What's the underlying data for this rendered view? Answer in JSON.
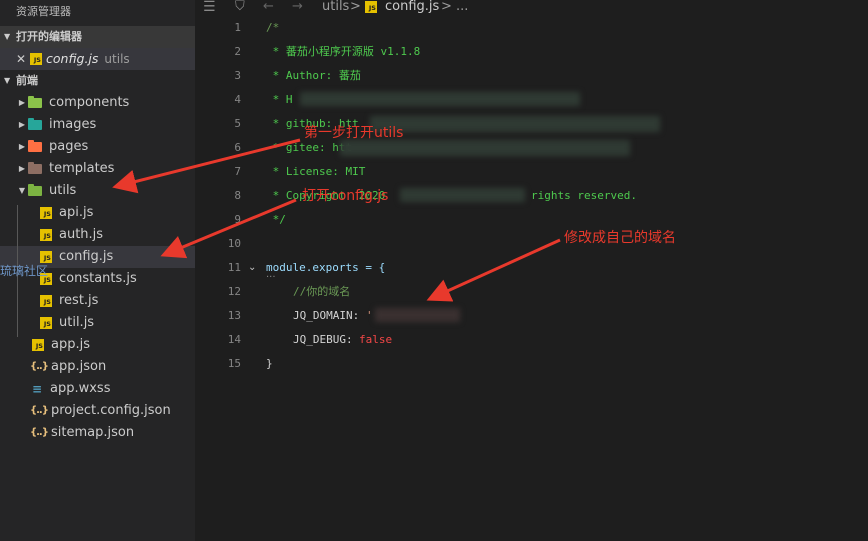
{
  "sidebar": {
    "title": "资源管理器",
    "open_editors": {
      "label": "打开的编辑器",
      "file": "config.js",
      "dir": "utils"
    },
    "project": {
      "label": "前端"
    },
    "tree": [
      {
        "label": "components",
        "type": "folder",
        "color": "#8bc34a"
      },
      {
        "label": "images",
        "type": "folder",
        "color": "#26a69a"
      },
      {
        "label": "pages",
        "type": "folder",
        "color": "#ff7043"
      },
      {
        "label": "templates",
        "type": "folder",
        "color": "#8d6e63"
      },
      {
        "label": "utils",
        "type": "folder-open",
        "color": "#7cb342"
      },
      {
        "label": "api.js",
        "type": "js"
      },
      {
        "label": "auth.js",
        "type": "js"
      },
      {
        "label": "config.js",
        "type": "js",
        "selected": true
      },
      {
        "label": "constants.js",
        "type": "js"
      },
      {
        "label": "rest.js",
        "type": "js"
      },
      {
        "label": "util.js",
        "type": "js"
      },
      {
        "label": "app.js",
        "type": "js"
      },
      {
        "label": "app.json",
        "type": "json"
      },
      {
        "label": "app.wxss",
        "type": "css"
      },
      {
        "label": "project.config.json",
        "type": "json"
      },
      {
        "label": "sitemap.json",
        "type": "json"
      }
    ]
  },
  "watermark": "琉璃社区",
  "breadcrumb": {
    "folder": "utils",
    "sep": ">",
    "file": "config.js",
    "more": "> ..."
  },
  "code": {
    "lines": [
      {
        "n": "1",
        "text": "/*"
      },
      {
        "n": "2",
        "text": " * 蕃茄小程序开源版 v1.1.8"
      },
      {
        "n": "3",
        "text": " * Author: 蕃茄"
      },
      {
        "n": "4",
        "text": " * H"
      },
      {
        "n": "5",
        "text": " * github: htt"
      },
      {
        "n": "6",
        "text": " * gitee: htt"
      },
      {
        "n": "7",
        "text": " * License: MIT"
      },
      {
        "n": "8",
        "text": " * Copyright  2020"
      },
      {
        "n": "9",
        "text": " */"
      },
      {
        "n": "10",
        "text": ""
      },
      {
        "n": "11",
        "text": "module.exports = {"
      },
      {
        "n": "12",
        "text": "    //你的域名"
      },
      {
        "n": "13",
        "text": "    JQ_DOMAIN: '"
      },
      {
        "n": "14",
        "text": "    JQ_DEBUG: false"
      },
      {
        "n": "15",
        "text": "}"
      }
    ],
    "rights_text": "rights reserved.",
    "debug_key": "JQ_DEBUG:",
    "debug_val": "false",
    "domain_key": "JQ_DOMAIN:",
    "domain_val": "'",
    "comment_domain": "//你的域名",
    "module_line": "module.exports = {",
    "fold_dots": "..."
  },
  "annotations": {
    "step1": "第一步打开utils",
    "step2": "打开config.js",
    "step3": "修改成自己的域名"
  },
  "colors": {
    "arrow": "#e8392c",
    "background": "#1e1e1e",
    "sidebar": "#252526"
  }
}
